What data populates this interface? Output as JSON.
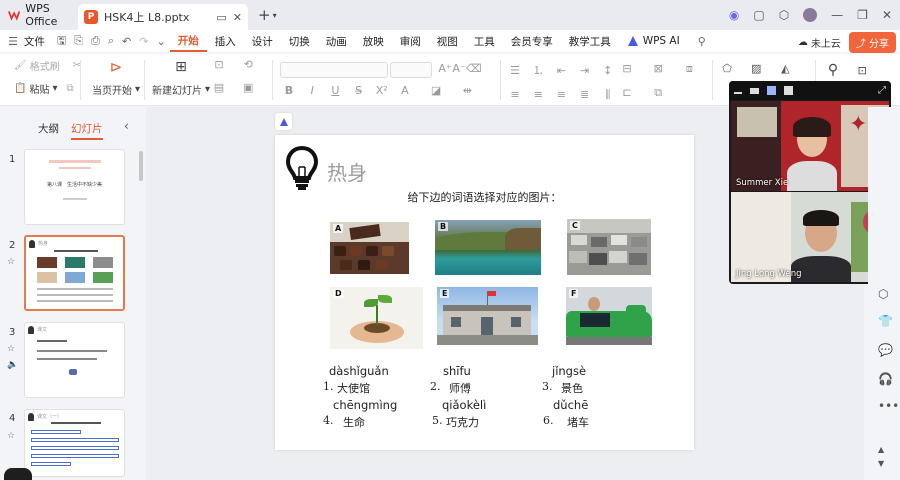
{
  "titlebar": {
    "app_tab": "WPS Office",
    "doc_tab": "HSK4上 L8.pptx",
    "doc_tag": "P"
  },
  "menu": {
    "file": "文件",
    "items": [
      "开始",
      "插入",
      "设计",
      "切换",
      "动画",
      "放映",
      "审阅",
      "视图",
      "工具",
      "会员专享",
      "教学工具",
      "WPS AI"
    ],
    "active": "开始",
    "cloud": "未上云",
    "share": "分享"
  },
  "ribbon": {
    "format_painter": "格式刷",
    "paste": "粘贴",
    "from_current": "当页开始",
    "new_slide": "新建幻灯片"
  },
  "leftpanel": {
    "tab_outline": "大纲",
    "tab_slides": "幻灯片",
    "thumbs": [
      {
        "num": "1",
        "line1": "第八课　生活中不缺少美"
      },
      {
        "num": "2",
        "line1": "热身"
      },
      {
        "num": "3",
        "line1": "课文"
      },
      {
        "num": "4",
        "line1": "课文（一）"
      }
    ]
  },
  "slide": {
    "title": "热身",
    "subtitle": "给下边的词语选择对应的图片：",
    "pictures": [
      "A",
      "B",
      "C",
      "D",
      "E",
      "F"
    ],
    "vocab": [
      {
        "pinyin": "dàshǐguǎn",
        "num": "1.",
        "word": "大使馆"
      },
      {
        "pinyin": "shīfu",
        "num": "2.",
        "word": "师傅"
      },
      {
        "pinyin": "jǐngsè",
        "num": "3.",
        "word": "景色"
      },
      {
        "pinyin": "chēngmìng",
        "num": "4.",
        "word": "生命"
      },
      {
        "pinyin": "qiǎokèlì",
        "num": "5.",
        "word": "巧克力"
      },
      {
        "pinyin": "dǔchē",
        "num": "6.",
        "word": "堵车"
      }
    ]
  },
  "video": {
    "participants": [
      {
        "name": "Summer Xie"
      },
      {
        "name": "Jing Long Weng"
      }
    ]
  },
  "colors": {
    "accent": "#e25d33",
    "share": "#f1653a"
  }
}
